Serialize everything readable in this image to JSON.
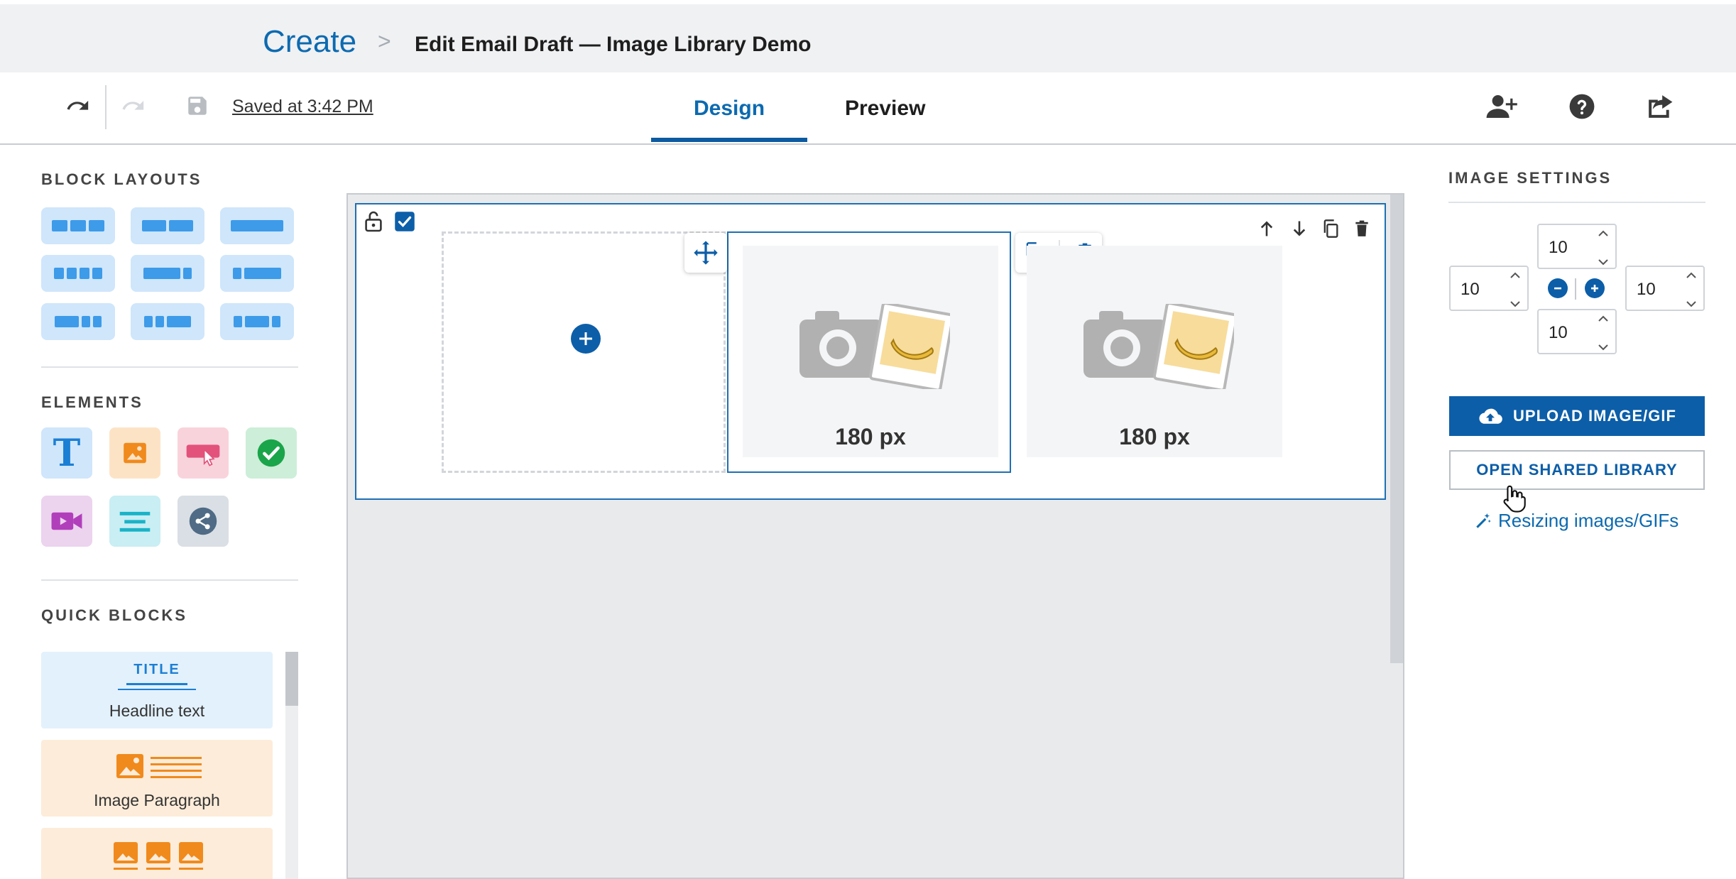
{
  "breadcrumb": {
    "root": "Create",
    "separator": ">",
    "title": "Edit Email Draft — Image Library Demo"
  },
  "toolbar": {
    "undo_icon": "undo-icon",
    "redo_icon": "redo-icon",
    "save_icon": "save-icon",
    "saved_text": "Saved at 3:42 PM",
    "tabs": [
      {
        "label": "Design",
        "active": true
      },
      {
        "label": "Preview",
        "active": false
      }
    ],
    "right_icons": [
      "add-user-icon",
      "help-icon",
      "share-icon"
    ]
  },
  "left_panel": {
    "block_layouts_title": "BLOCK LAYOUTS",
    "elements_title": "ELEMENTS",
    "elements": [
      {
        "name": "text",
        "glyph": "T",
        "bg": "#cfe6fb",
        "fg": "#1b7fd4"
      },
      {
        "name": "image",
        "bg": "#fde3c6",
        "fg": "#f08a1c"
      },
      {
        "name": "button",
        "bg": "#f9d3dc",
        "fg": "#e2527a"
      },
      {
        "name": "checkmark",
        "bg": "#cdeed8",
        "fg": "#1aa54a"
      },
      {
        "name": "video",
        "bg": "#ecd3ee",
        "fg": "#b13fbb"
      },
      {
        "name": "divider",
        "bg": "#c9eef3",
        "fg": "#19b3c8"
      },
      {
        "name": "social-share",
        "bg": "#d9dfe5",
        "fg": "#4f6b85"
      }
    ],
    "quick_blocks_title": "QUICK BLOCKS",
    "quick_blocks": [
      {
        "label": "Headline text",
        "icon_text": "TITLE",
        "bg": "#e3f1fc"
      },
      {
        "label": "Image Paragraph",
        "bg": "#fdecd9"
      },
      {
        "label": "",
        "bg": "#fdecd9"
      }
    ]
  },
  "canvas": {
    "columns": [
      {
        "type": "empty"
      },
      {
        "type": "image",
        "label": "180 px"
      },
      {
        "type": "image",
        "label": "180 px"
      }
    ]
  },
  "image_settings": {
    "title": "IMAGE SETTINGS",
    "padding": {
      "top": "10",
      "left": "10",
      "right": "10",
      "bottom": "10"
    },
    "upload_label": "UPLOAD IMAGE/GIF",
    "shared_label": "OPEN SHARED LIBRARY",
    "resize_link": "Resizing images/GIFs"
  },
  "colors": {
    "brand": "#0c5ea8",
    "accent_link": "#0c6ab0",
    "canvas_bg": "#e9eaec"
  }
}
